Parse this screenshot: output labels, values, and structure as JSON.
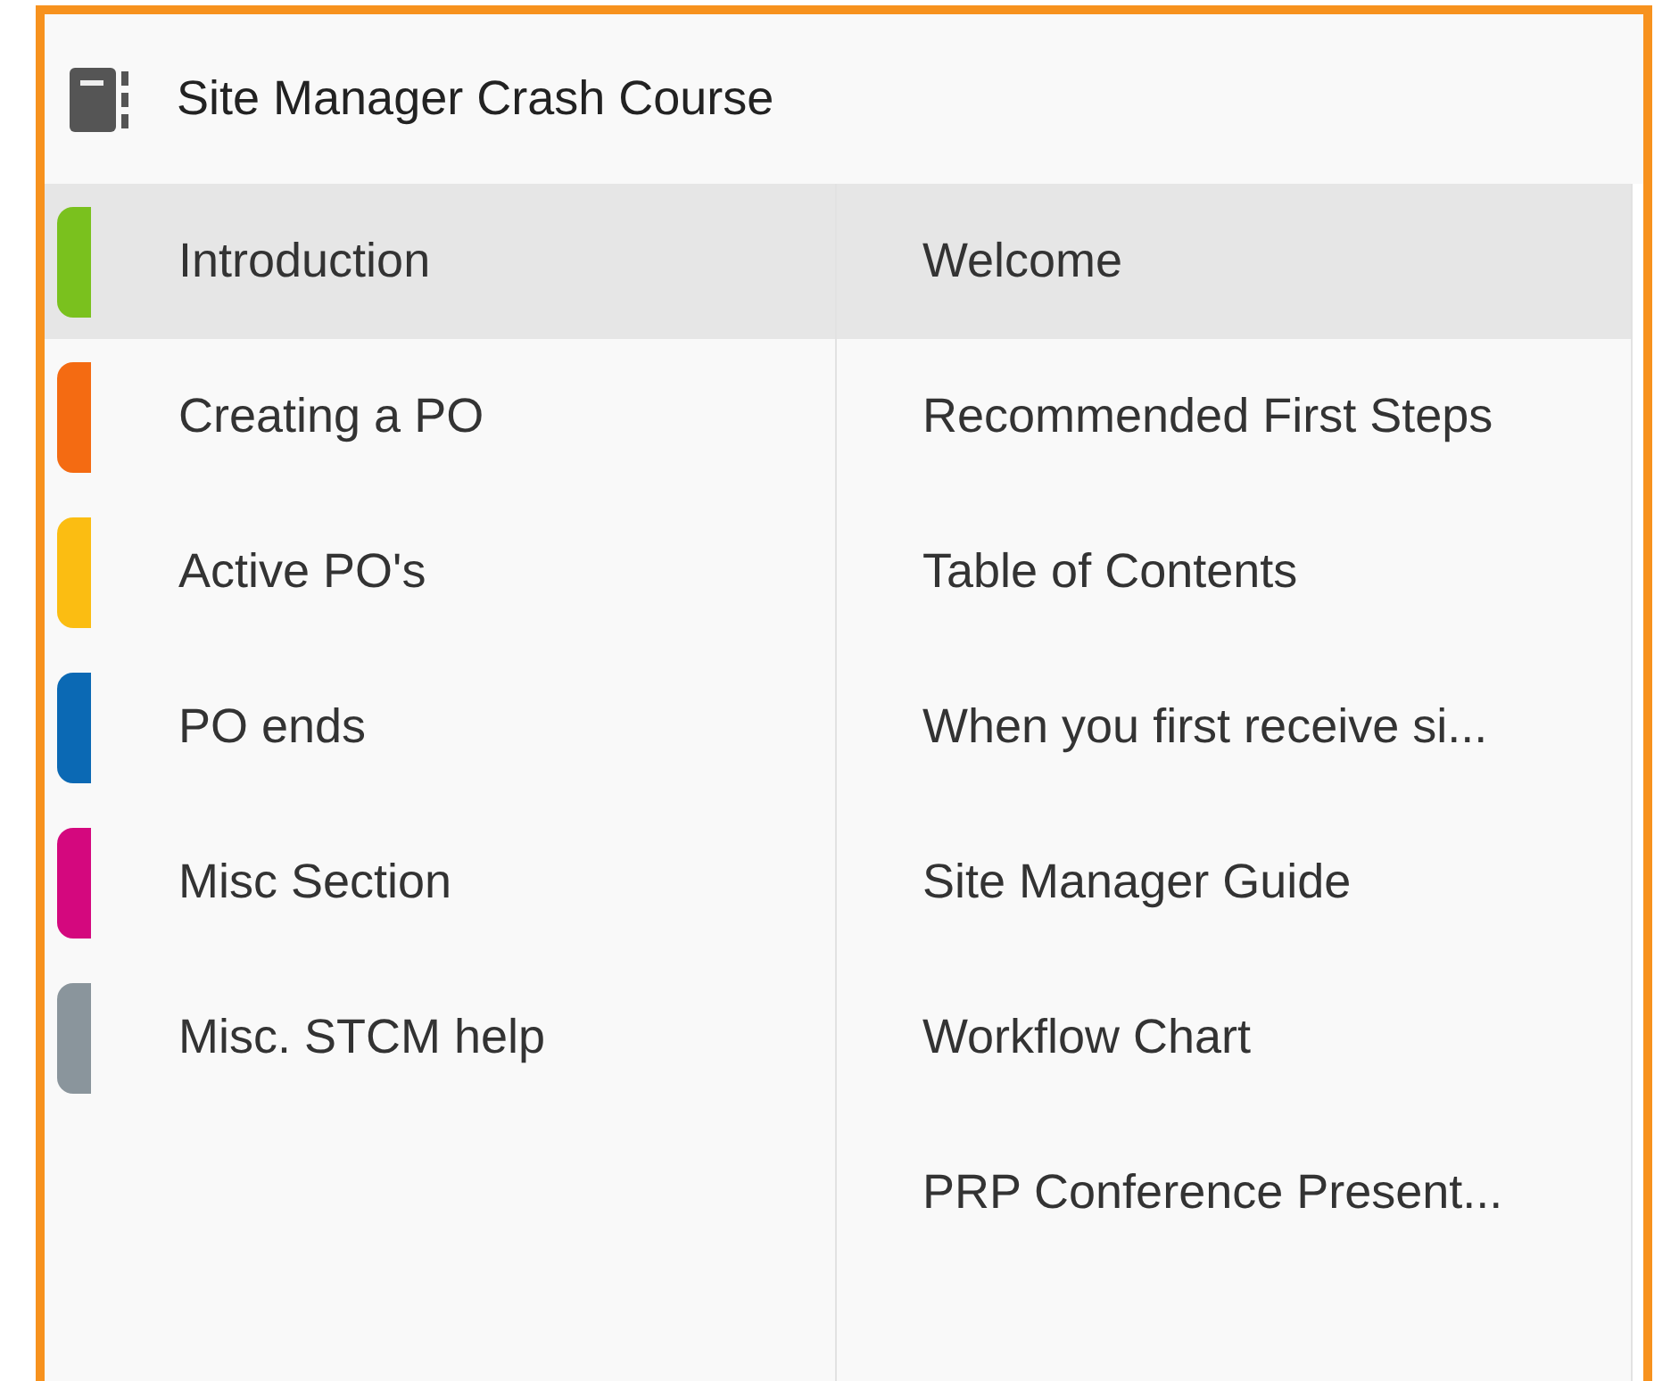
{
  "notebook": {
    "title": "Site Manager Crash Course"
  },
  "sections": [
    {
      "label": "Introduction",
      "color": "#7ac11e",
      "selected": true
    },
    {
      "label": "Creating a PO",
      "color": "#f46b12",
      "selected": false
    },
    {
      "label": "Active PO's",
      "color": "#fbbd12",
      "selected": false
    },
    {
      "label": "PO ends",
      "color": "#0b69b4",
      "selected": false
    },
    {
      "label": "Misc Section",
      "color": "#d4087e",
      "selected": false
    },
    {
      "label": "Misc. STCM help",
      "color": "#8a959c",
      "selected": false
    }
  ],
  "pages": [
    {
      "label": "Welcome",
      "selected": true
    },
    {
      "label": "Recommended First Steps",
      "selected": false
    },
    {
      "label": "Table of Contents",
      "selected": false
    },
    {
      "label": "When you first receive si...",
      "selected": false
    },
    {
      "label": "Site Manager Guide",
      "selected": false
    },
    {
      "label": "Workflow Chart",
      "selected": false
    },
    {
      "label": "PRP Conference Present...",
      "selected": false
    }
  ]
}
